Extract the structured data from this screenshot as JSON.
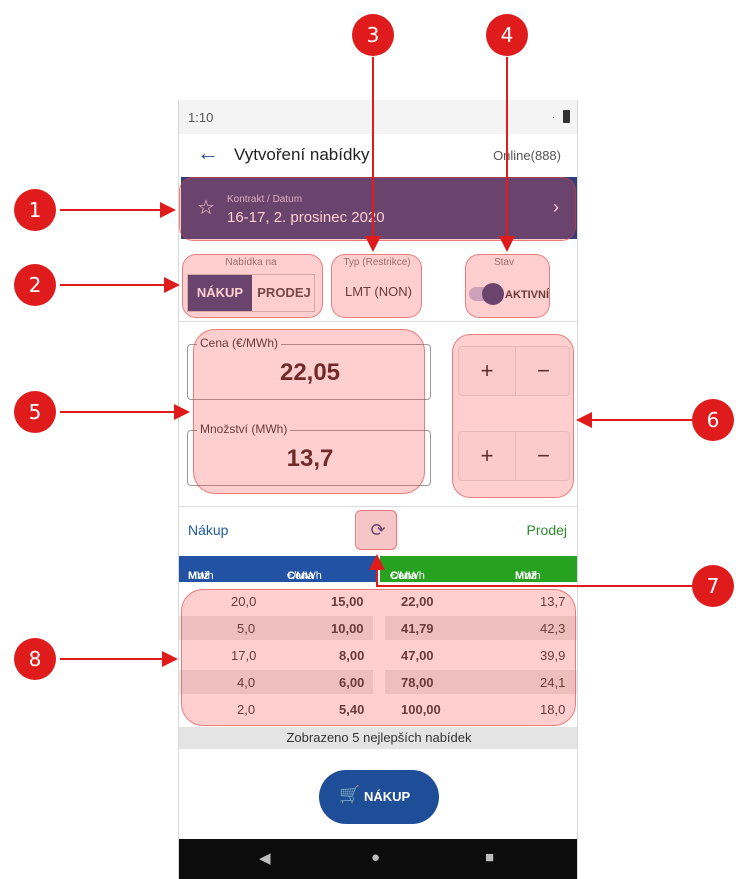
{
  "status_bar": {
    "time": "1:10",
    "signal": "."
  },
  "app_bar": {
    "back_icon": "arrow-left-icon",
    "title": "Vytvoření nabídky",
    "online": "Online(888)"
  },
  "contract": {
    "label": "Kontrakt / Datum",
    "value": "16-17, 2. prosinec 2020"
  },
  "offer_on": {
    "label": "Nabídka na",
    "options": [
      "NÁKUP",
      "PRODEJ"
    ],
    "selected": "NÁKUP"
  },
  "type": {
    "label": "Typ (Restrikce)",
    "value": "LMT (NON)"
  },
  "state": {
    "label": "Stav",
    "value": "AKTIVNÍ",
    "on": true
  },
  "price": {
    "label": "Cena (€/MWh)",
    "value": "22,05"
  },
  "quantity": {
    "label": "Množství (MWh)",
    "value": "13,7"
  },
  "steppers": {
    "plus": "+",
    "minus": "−"
  },
  "book": {
    "buy_label": "Nákup",
    "sell_label": "Prodej",
    "headers": {
      "buy_qty": "Mnž",
      "buy_qty_unit": "MWh",
      "buy_price": "Cena",
      "buy_price_unit": "€/MWh",
      "sell_price": "Cena",
      "sell_price_unit": "€/MWh",
      "sell_qty": "Mnž",
      "sell_qty_unit": "MWh"
    },
    "rows": [
      {
        "buy_qty": "20,0",
        "buy_price": "15,00",
        "sell_price": "22,00",
        "sell_qty": "13,7"
      },
      {
        "buy_qty": "5,0",
        "buy_price": "10,00",
        "sell_price": "41,79",
        "sell_qty": "42,3"
      },
      {
        "buy_qty": "17,0",
        "buy_price": "8,00",
        "sell_price": "47,00",
        "sell_qty": "39,9"
      },
      {
        "buy_qty": "4,0",
        "buy_price": "6,00",
        "sell_price": "78,00",
        "sell_qty": "24,1"
      },
      {
        "buy_qty": "2,0",
        "buy_price": "5,40",
        "sell_price": "100,00",
        "sell_qty": "18,0"
      }
    ],
    "note": "Zobrazeno 5 nejlepších nabídek"
  },
  "action": {
    "label": "NÁKUP",
    "icon": "cart-icon"
  },
  "callouts": [
    "1",
    "2",
    "3",
    "4",
    "5",
    "6",
    "7",
    "8"
  ],
  "colors": {
    "primary": "#33407a",
    "buy": "#2152a3",
    "sell": "#27a120",
    "callout": "#e01b1b"
  }
}
